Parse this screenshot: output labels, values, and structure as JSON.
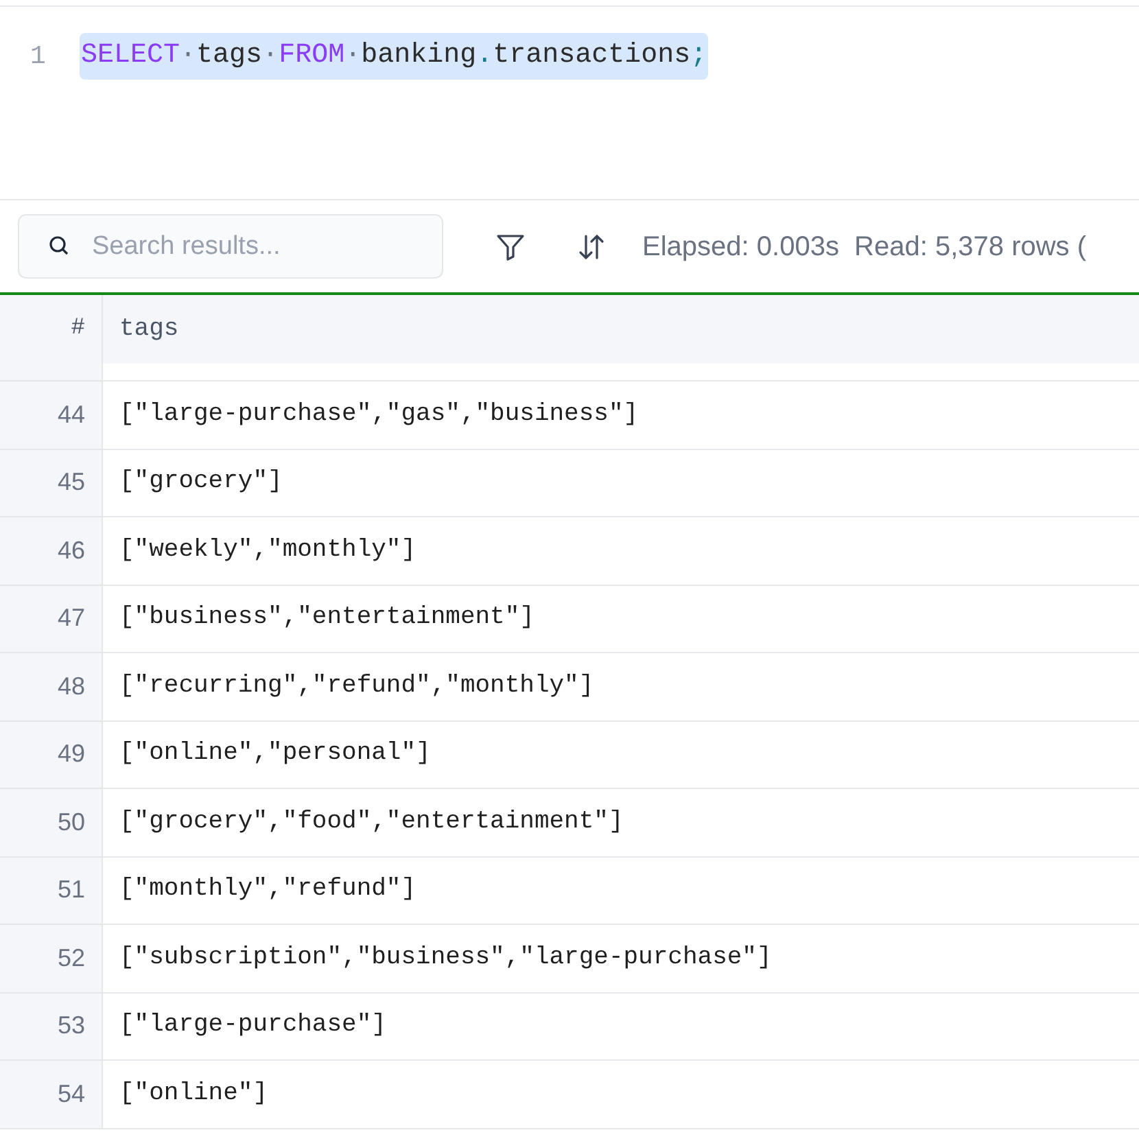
{
  "editor": {
    "lines": [
      {
        "number": "1",
        "selected": true,
        "tokens": [
          {
            "kind": "keyword",
            "text": "SELECT"
          },
          {
            "kind": "space",
            "text": "·"
          },
          {
            "kind": "ident",
            "text": "tags"
          },
          {
            "kind": "space",
            "text": "·"
          },
          {
            "kind": "keyword",
            "text": "FROM"
          },
          {
            "kind": "space",
            "text": "·"
          },
          {
            "kind": "ident",
            "text": "banking"
          },
          {
            "kind": "punct",
            "text": "."
          },
          {
            "kind": "ident",
            "text": "transactions"
          },
          {
            "kind": "punct",
            "text": ";"
          }
        ]
      }
    ]
  },
  "toolbar": {
    "search": {
      "placeholder": "Search results..."
    },
    "status": "Elapsed: 0.003s  Read: 5,378 rows ("
  },
  "table": {
    "columns": [
      "#",
      "tags"
    ],
    "rows": [
      {
        "number": "44",
        "tags": "[\"large-purchase\",\"gas\",\"business\"]"
      },
      {
        "number": "45",
        "tags": "[\"grocery\"]"
      },
      {
        "number": "46",
        "tags": "[\"weekly\",\"monthly\"]"
      },
      {
        "number": "47",
        "tags": "[\"business\",\"entertainment\"]"
      },
      {
        "number": "48",
        "tags": "[\"recurring\",\"refund\",\"monthly\"]"
      },
      {
        "number": "49",
        "tags": "[\"online\",\"personal\"]"
      },
      {
        "number": "50",
        "tags": "[\"grocery\",\"food\",\"entertainment\"]"
      },
      {
        "number": "51",
        "tags": "[\"monthly\",\"refund\"]"
      },
      {
        "number": "52",
        "tags": "[\"subscription\",\"business\",\"large-purchase\"]"
      },
      {
        "number": "53",
        "tags": "[\"large-purchase\"]"
      },
      {
        "number": "54",
        "tags": "[\"online\"]"
      }
    ]
  }
}
